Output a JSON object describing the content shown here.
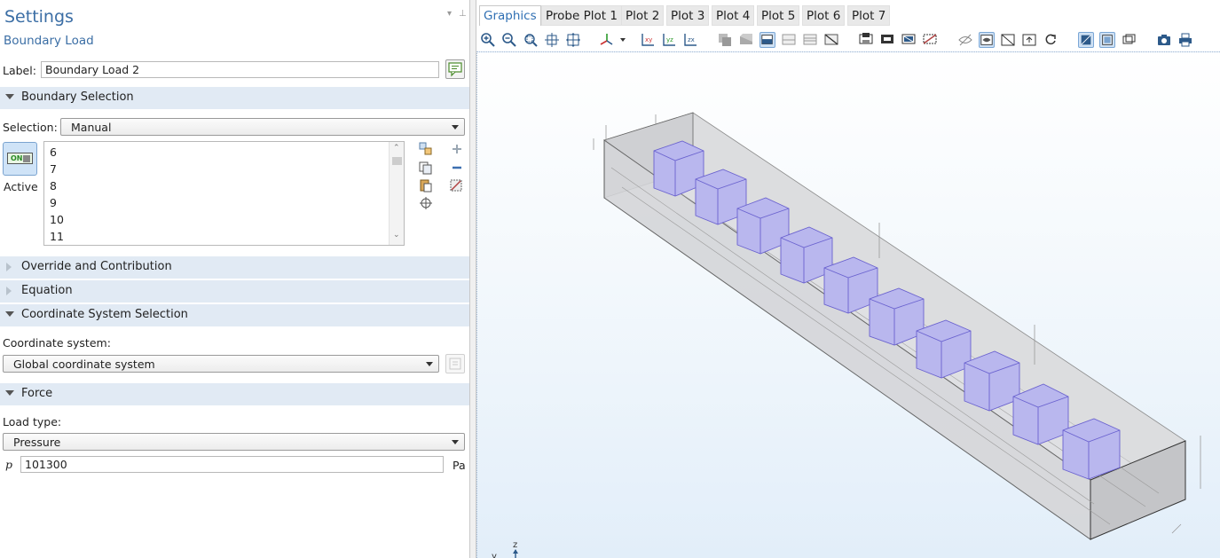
{
  "settings": {
    "title": "Settings",
    "subtitle": "Boundary Load",
    "label_caption": "Label:",
    "label_value": "Boundary Load 2"
  },
  "boundary_selection": {
    "title": "Boundary Selection",
    "selection_caption": "Selection:",
    "selection_value": "Manual",
    "active_label": "Active",
    "toggle_text": "ON",
    "items": [
      "6",
      "7",
      "8",
      "9",
      "10",
      "11"
    ]
  },
  "sections": {
    "override": "Override and Contribution",
    "equation": "Equation",
    "coordinate": "Coordinate System Selection",
    "force": "Force"
  },
  "coordinate": {
    "caption": "Coordinate system:",
    "value": "Global coordinate system"
  },
  "force": {
    "load_type_caption": "Load type:",
    "load_type_value": "Pressure",
    "p_symbol": "p",
    "p_value": "101300",
    "p_unit": "Pa"
  },
  "graphics": {
    "tabs": [
      "Graphics",
      "Probe Plot 1",
      "Plot 2",
      "Plot 3",
      "Plot 4",
      "Plot 5",
      "Plot 6",
      "Plot 7"
    ],
    "active_tab": "Graphics",
    "axis_z": "z",
    "axis_y": "y",
    "colors": {
      "box_fill": "#d8d9dc",
      "cube_fill": "#b7b5ec",
      "cube_edge": "#6a62cf",
      "edge": "#555555",
      "accent": "#2f6fb3"
    }
  },
  "toolbar_icons": [
    "zoom-in-icon",
    "zoom-out-icon",
    "zoom-box-icon",
    "zoom-selected-icon",
    "zoom-extents-icon",
    "views-icon",
    "view-xy-icon",
    "view-yz-icon",
    "view-zx-icon",
    "select-objects-icon",
    "select-domains-icon",
    "select-boundaries-icon",
    "select-edges-icon",
    "select-points-icon",
    "deselect-icon",
    "hide-icon-1",
    "hide-icon-2",
    "hide-icon-3",
    "hide-icon-4",
    "transparency-icon",
    "wireframe-icon",
    "show-grid-icon",
    "show-axes-icon",
    "reset-icon",
    "scene-light-icon",
    "render-icon",
    "layout-icon",
    "camera-icon",
    "print-icon"
  ]
}
